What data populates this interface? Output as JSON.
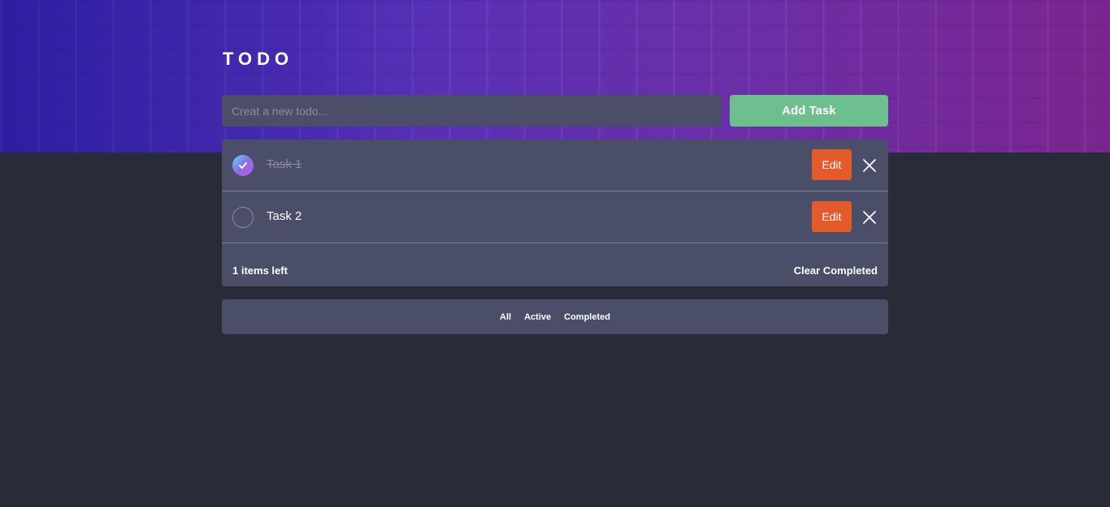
{
  "header": {
    "title": "TODO"
  },
  "new_todo": {
    "placeholder": "Creat a new todo...",
    "value": ""
  },
  "add_button": {
    "label": "Add Task"
  },
  "todos": [
    {
      "text": "Task 1",
      "completed": true,
      "edit_label": "Edit"
    },
    {
      "text": "Task 2",
      "completed": false,
      "edit_label": "Edit"
    }
  ],
  "footer": {
    "items_left": "1 items left",
    "clear_label": "Clear Completed"
  },
  "filters": [
    "All",
    "Active",
    "Completed"
  ],
  "colors": {
    "background": "#282b38",
    "card": "#4a4e69",
    "add_button": "#6dbf8e",
    "edit_button": "#e55a2b",
    "check_gradient_start": "#57ddff",
    "check_gradient_end": "#c058f3"
  },
  "icons": {
    "check": "check-icon",
    "delete": "close-icon"
  }
}
